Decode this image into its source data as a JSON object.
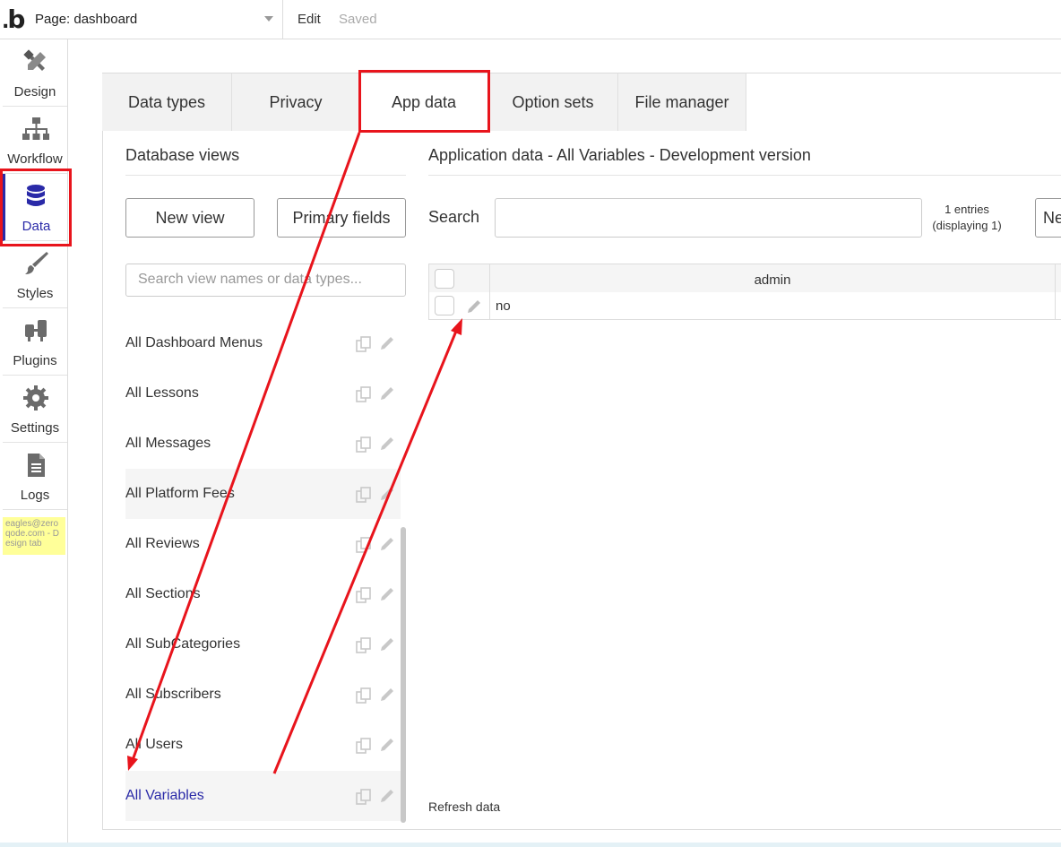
{
  "topbar": {
    "logo": "b",
    "page_label": "Page: dashboard",
    "edit_label": "Edit",
    "saved_label": "Saved"
  },
  "sidebar": {
    "items": [
      {
        "label": "Design",
        "icon": "design-icon"
      },
      {
        "label": "Workflow",
        "icon": "workflow-icon"
      },
      {
        "label": "Data",
        "icon": "database-icon",
        "active": true
      },
      {
        "label": "Styles",
        "icon": "brush-icon"
      },
      {
        "label": "Plugins",
        "icon": "plug-icon"
      },
      {
        "label": "Settings",
        "icon": "gear-icon"
      },
      {
        "label": "Logs",
        "icon": "document-icon"
      }
    ],
    "user_note": "eagles@zeroqode.com - Design tab"
  },
  "tabs": [
    {
      "label": "Data types"
    },
    {
      "label": "Privacy"
    },
    {
      "label": "App data",
      "active": true
    },
    {
      "label": "Option sets"
    },
    {
      "label": "File manager"
    }
  ],
  "views_panel": {
    "title": "Database views",
    "new_view_label": "New view",
    "primary_fields_label": "Primary fields",
    "search_placeholder": "Search view names or data types...",
    "views": [
      {
        "name": "All Dashboard Menus"
      },
      {
        "name": "All Lessons"
      },
      {
        "name": "All Messages"
      },
      {
        "name": "All Platform Fees"
      },
      {
        "name": "All Reviews"
      },
      {
        "name": "All Sections"
      },
      {
        "name": "All SubCategories"
      },
      {
        "name": "All Subscribers"
      },
      {
        "name": "All Users"
      },
      {
        "name": "All Variables",
        "selected": true
      }
    ]
  },
  "data_panel": {
    "title": "Application data - All Variables - Development version",
    "search_label": "Search",
    "entries_count": "1 entries",
    "entries_display": "(displaying 1)",
    "new_entry_label": "Ne",
    "table": {
      "columns": [
        "admin"
      ],
      "rows": [
        [
          "no"
        ]
      ]
    },
    "refresh_label": "Refresh data"
  },
  "colors": {
    "accent": "#2a2aa8",
    "annotation": "#e8141c",
    "note_bg": "#ffff99"
  }
}
